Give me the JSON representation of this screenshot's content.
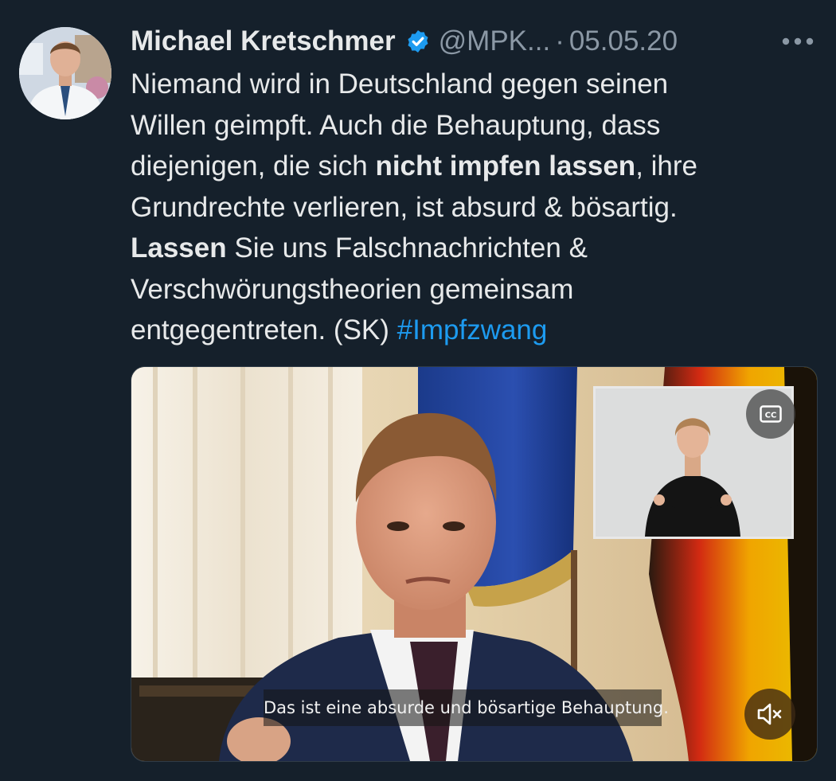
{
  "tweet": {
    "author_name": "Michael Kretschmer",
    "handle": "@MPK...",
    "separator": "·",
    "date": "05.05.20",
    "lines": {
      "l1": "Niemand wird in Deutschland gegen seinen",
      "l2": "Willen geimpft. Auch die Behauptung, dass",
      "l3_pre": "diejenigen, die sich ",
      "l3_bold": "nicht impfen lassen",
      "l3_post": ", ihre",
      "l4": "Grundrechte verlieren, ist absurd & bösartig.",
      "l5_bold": "Lassen",
      "l5_post": " Sie uns Falschnachrichten &",
      "l6": "Verschwörungstheorien  gemeinsam",
      "l7_pre": "entgegentreten. (SK) ",
      "l7_hashtag": "#Impfzwang"
    }
  },
  "video": {
    "subtitle": "Das ist eine absurde und bösartige Behauptung.",
    "cc_label": "CC",
    "icons": {
      "avatar": "avatar",
      "verified": "verified-badge-icon",
      "more": "more-options-icon",
      "cc": "closed-captions-icon",
      "mute": "speaker-muted-icon"
    }
  },
  "colors": {
    "background": "#15202b",
    "text": "#e7e9ea",
    "secondary_text": "#8b98a5",
    "link": "#1d9bf0",
    "verified": "#1d9bf0"
  }
}
